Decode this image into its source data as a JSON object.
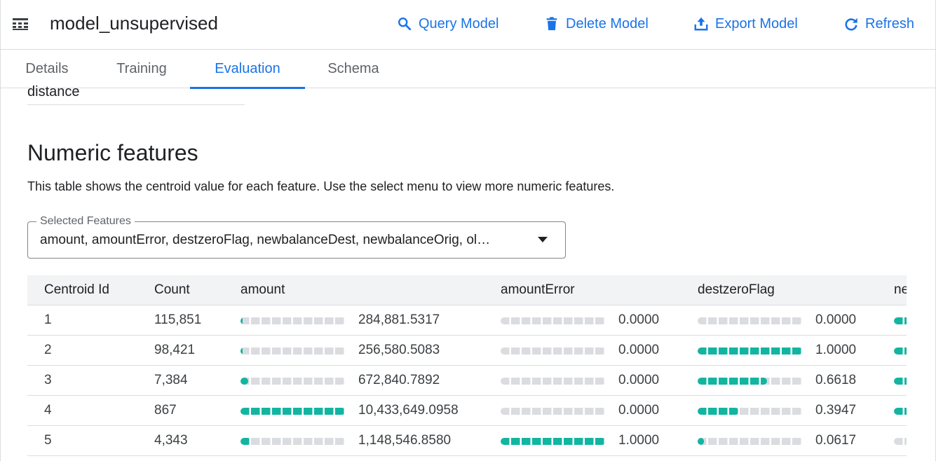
{
  "header": {
    "model_icon": "table-grid-icon",
    "title": "model_unsupervised",
    "actions": [
      {
        "label": "Query Model",
        "icon": "search-icon"
      },
      {
        "label": "Delete Model",
        "icon": "trash-icon"
      },
      {
        "label": "Export Model",
        "icon": "export-icon"
      },
      {
        "label": "Refresh",
        "icon": "refresh-icon"
      }
    ]
  },
  "tabs": [
    {
      "label": "Details",
      "active": false
    },
    {
      "label": "Training",
      "active": false
    },
    {
      "label": "Evaluation",
      "active": true
    },
    {
      "label": "Schema",
      "active": false
    }
  ],
  "content": {
    "distance_text": "distance",
    "section_title": "Numeric features",
    "section_description": "This table shows the centroid value for each feature. Use the select menu to view more numeric features.",
    "select": {
      "label": "Selected Features",
      "value": "amount, amountError, destzeroFlag, newbalanceDest, newbalanceOrig, ol…"
    }
  },
  "table": {
    "columns": [
      "Centroid Id",
      "Count",
      "amount",
      "amountError",
      "destzeroFlag",
      "ne"
    ],
    "rows": [
      {
        "id": "1",
        "count": "115,851",
        "amount": "284,881.5317",
        "amount_frac": 0.02,
        "amountError": "0.0000",
        "amountError_frac": 0,
        "destzeroFlag": "0.0000",
        "destzeroFlag_frac": 0,
        "next_frac": 0.25
      },
      {
        "id": "2",
        "count": "98,421",
        "amount": "256,580.5083",
        "amount_frac": 0.02,
        "amountError": "0.0000",
        "amountError_frac": 0,
        "destzeroFlag": "1.0000",
        "destzeroFlag_frac": 1.0,
        "next_frac": 0.25
      },
      {
        "id": "3",
        "count": "7,384",
        "amount": "672,840.7892",
        "amount_frac": 0.07,
        "amountError": "0.0000",
        "amountError_frac": 0,
        "destzeroFlag": "0.6618",
        "destzeroFlag_frac": 0.6618,
        "next_frac": 0.4
      },
      {
        "id": "4",
        "count": "867",
        "amount": "10,433,649.0958",
        "amount_frac": 1.0,
        "amountError": "0.0000",
        "amountError_frac": 0,
        "destzeroFlag": "0.3947",
        "destzeroFlag_frac": 0.3947,
        "next_frac": 0.25
      },
      {
        "id": "5",
        "count": "4,343",
        "amount": "1,148,546.8580",
        "amount_frac": 0.1,
        "amountError": "1.0000",
        "amountError_frac": 1.0,
        "destzeroFlag": "0.0617",
        "destzeroFlag_frac": 0.0617,
        "next_frac": 0
      }
    ]
  },
  "colors": {
    "accent": "#1a73e8",
    "bar_fill": "#12b5a0",
    "bar_track": "#dadce0",
    "header_bg": "#f1f3f4"
  }
}
